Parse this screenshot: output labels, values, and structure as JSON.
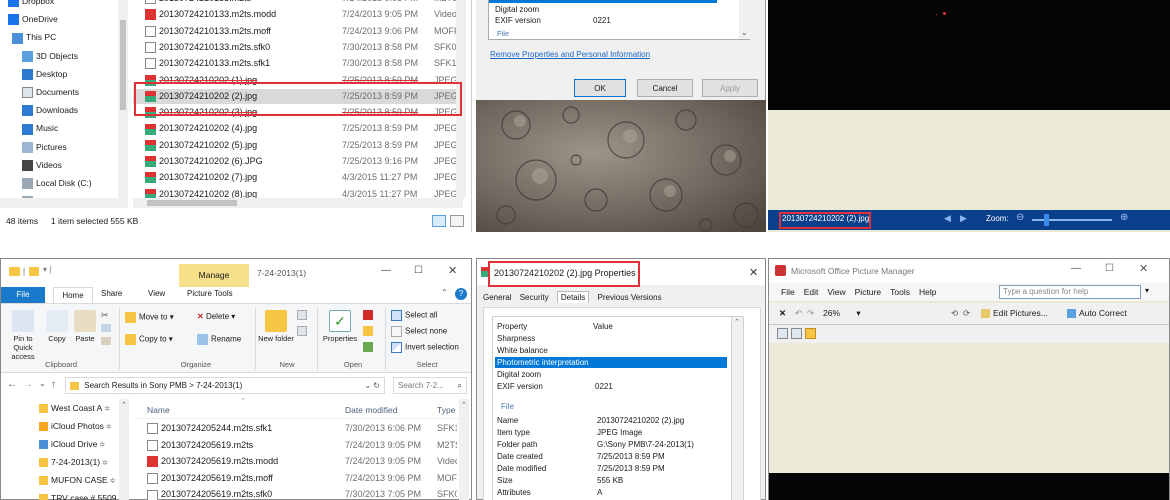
{
  "top": {
    "nav_items": [
      {
        "label": "Dropbox",
        "icon": "dropbox-icon"
      },
      {
        "label": "OneDrive",
        "icon": "onedrive-icon"
      },
      {
        "label": "This PC",
        "icon": "computer-icon"
      },
      {
        "label": "3D Objects",
        "icon": "3d-objects-icon"
      },
      {
        "label": "Desktop",
        "icon": "desktop-icon"
      },
      {
        "label": "Documents",
        "icon": "documents-icon"
      },
      {
        "label": "Downloads",
        "icon": "download-icon"
      },
      {
        "label": "Music",
        "icon": "music-icon"
      },
      {
        "label": "Pictures",
        "icon": "pictures-icon"
      },
      {
        "label": "Videos",
        "icon": "videos-icon"
      },
      {
        "label": "Local Disk (C:)",
        "icon": "drive-icon"
      },
      {
        "label": "FantomHD (D:)",
        "icon": "drive-icon"
      }
    ],
    "files": [
      {
        "name": "20130724210133.m2ts",
        "date": "7/24/2013 9:05 PM",
        "type": "M2TS",
        "icon": "video-file-icon"
      },
      {
        "name": "20130724210133.m2ts.modd",
        "date": "7/24/2013 9:05 PM",
        "type": "Video",
        "icon": "modd-file-icon"
      },
      {
        "name": "20130724210133.m2ts.moff",
        "date": "7/24/2013 9:06 PM",
        "type": "MOFF",
        "icon": "file-icon"
      },
      {
        "name": "20130724210133.m2ts.sfk0",
        "date": "7/30/2013 8:58 PM",
        "type": "SFK0",
        "icon": "file-icon"
      },
      {
        "name": "20130724210133.m2ts.sfk1",
        "date": "7/30/2013 8:58 PM",
        "type": "SFK1",
        "icon": "file-icon"
      },
      {
        "name": "20130724210202 (1).jpg",
        "date": "7/25/2013 8:59 PM",
        "type": "JPEG I",
        "icon": "jpeg-file-icon"
      },
      {
        "name": "20130724210202 (2).jpg",
        "date": "7/25/2013 8:59 PM",
        "type": "JPEG I",
        "icon": "jpeg-file-icon"
      },
      {
        "name": "20130724210202 (3).jpg",
        "date": "7/25/2013 8:59 PM",
        "type": "JPEG I",
        "icon": "jpeg-file-icon"
      },
      {
        "name": "20130724210202 (4).jpg",
        "date": "7/25/2013 8:59 PM",
        "type": "JPEG I",
        "icon": "jpeg-file-icon"
      },
      {
        "name": "20130724210202 (5).jpg",
        "date": "7/25/2013 8:59 PM",
        "type": "JPEG I",
        "icon": "jpeg-file-icon"
      },
      {
        "name": "20130724210202 (6).JPG",
        "date": "7/25/2013 9:16 PM",
        "type": "JPEG I",
        "icon": "jpeg-file-icon"
      },
      {
        "name": "20130724210202 (7).jpg",
        "date": "4/3/2015 11:27 PM",
        "type": "JPEG I",
        "icon": "jpeg-file-icon"
      },
      {
        "name": "20130724210202 (8).jpg",
        "date": "4/3/2015 11:27 PM",
        "type": "JPEG I",
        "icon": "jpeg-file-icon"
      }
    ],
    "status": {
      "items": "48 items",
      "selected": "1 item selected  555 KB"
    },
    "props": {
      "rows": [
        {
          "label": "Digital zoom",
          "value": ""
        },
        {
          "label": "EXIF version",
          "value": "0221"
        }
      ],
      "section": "File",
      "remove_link": "Remove Properties and Personal Information",
      "ok": "OK",
      "cancel": "Cancel",
      "apply": "Apply"
    },
    "viewer": {
      "filename": "20130724210202 (2).jpg",
      "zoom": "Zoom:"
    }
  },
  "bottom": {
    "explorer": {
      "title": "7-24-2013(1)",
      "context_tab": "Manage",
      "context_group": "Picture Tools",
      "tabs": [
        "File",
        "Home",
        "Share",
        "View",
        "Picture Tools"
      ],
      "ribbon": {
        "pin": "Pin to Quick access",
        "copy": "Copy",
        "paste": "Paste",
        "clipboard": "Clipboard",
        "move_to": "Move to",
        "copy_to": "Copy to",
        "delete": "Delete",
        "rename": "Rename",
        "organize": "Organize",
        "new_folder": "New folder",
        "new": "New",
        "properties": "Properties",
        "open": "Open",
        "select_all": "Select all",
        "select_none": "Select none",
        "invert": "Invert selection",
        "select": "Select"
      },
      "breadcrumb": "Search Results in Sony PMB  >  7-24-2013(1)",
      "search_placeholder": "Search 7-2...",
      "col_name": "Name",
      "col_date": "Date modified",
      "col_type": "Type",
      "nav_items": [
        {
          "label": "West Coast A",
          "icon": "folder-icon"
        },
        {
          "label": "iCloud Photos",
          "icon": "icloud-photos-icon"
        },
        {
          "label": "iCloud Drive",
          "icon": "icloud-drive-icon"
        },
        {
          "label": "7-24-2013(1)",
          "icon": "folder-icon"
        },
        {
          "label": "MUFON CASE",
          "icon": "folder-icon"
        },
        {
          "label": "TRV case # 5509",
          "icon": "folder-icon"
        }
      ],
      "files": [
        {
          "name": "20130724205244.m2ts.sfk1",
          "date": "7/30/2013 6:06 PM",
          "type": "SFK1",
          "icon": "file-icon"
        },
        {
          "name": "20130724205619.m2ts",
          "date": "7/24/2013 9:05 PM",
          "type": "M2TS",
          "icon": "video-file-icon"
        },
        {
          "name": "20130724205619.m2ts.modd",
          "date": "7/24/2013 9:05 PM",
          "type": "Video",
          "icon": "modd-file-icon"
        },
        {
          "name": "20130724205619.m2ts.moff",
          "date": "7/24/2013 9:06 PM",
          "type": "MOFF",
          "icon": "file-icon"
        },
        {
          "name": "20130724205619.m2ts.sfk0",
          "date": "7/30/2013 7:05 PM",
          "type": "SFK0",
          "icon": "file-icon"
        }
      ]
    },
    "props": {
      "title": "20130724210202 (2).jpg Properties",
      "tabs": [
        "General",
        "Security",
        "Details",
        "Previous Versions"
      ],
      "header_property": "Property",
      "header_value": "Value",
      "rows": [
        {
          "label": "Sharpness",
          "value": ""
        },
        {
          "label": "White balance",
          "value": ""
        },
        {
          "label": "Photometric interpretation",
          "value": ""
        },
        {
          "label": "Digital zoom",
          "value": ""
        },
        {
          "label": "EXIF version",
          "value": "0221"
        }
      ],
      "section": "File",
      "file_rows": [
        {
          "label": "Name",
          "value": "20130724210202 (2).jpg"
        },
        {
          "label": "Item type",
          "value": "JPEG Image"
        },
        {
          "label": "Folder path",
          "value": "G:\\Sony PMB\\7-24-2013(1)"
        },
        {
          "label": "Date created",
          "value": "7/25/2013 8:59 PM"
        },
        {
          "label": "Date modified",
          "value": "7/25/2013 8:59 PM"
        },
        {
          "label": "Size",
          "value": "555 KB"
        },
        {
          "label": "Attributes",
          "value": "A"
        }
      ]
    },
    "picmgr": {
      "title": "Microsoft Office Picture Manager",
      "menu": [
        "File",
        "Edit",
        "View",
        "Picture",
        "Tools",
        "Help"
      ],
      "help_placeholder": "Type a question for help",
      "zoom": "26%",
      "edit_pictures": "Edit Pictures...",
      "auto_correct": "Auto Correct"
    }
  },
  "colors": {
    "highlight": "#e0303a",
    "selection": "#cce8ff",
    "accent": "#0078d7",
    "manage_tab": "#f7e08a"
  }
}
